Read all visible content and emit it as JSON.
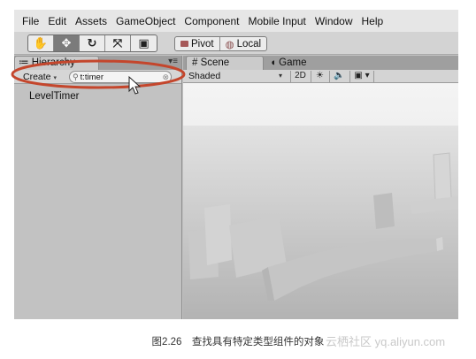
{
  "menubar": {
    "items": [
      "File",
      "Edit",
      "Assets",
      "GameObject",
      "Component",
      "Mobile Input",
      "Window",
      "Help"
    ]
  },
  "toolbar": {
    "tools": [
      {
        "icon": "hand-icon",
        "glyph": "✋"
      },
      {
        "icon": "move-icon",
        "glyph": "✥"
      },
      {
        "icon": "rotate-icon",
        "glyph": "↻"
      },
      {
        "icon": "scale-icon",
        "glyph": "⤧"
      },
      {
        "icon": "rect-icon",
        "glyph": "▣"
      }
    ],
    "active_tool": 1,
    "pivot_label": "Pivot",
    "local_label": "Local"
  },
  "hierarchy": {
    "tab_label": "Hierarchy",
    "create_label": "Create",
    "search_value": "t:timer",
    "items": [
      "LevelTimer"
    ]
  },
  "scene": {
    "tab_scene": "Scene",
    "tab_game": "Game",
    "shading_mode": "Shaded",
    "mode_2d": "2D"
  },
  "colors": {
    "highlight_ellipse": "#c4462c",
    "panel_bg": "#c2c2c2",
    "toolbar_bg": "#d3d3d3"
  },
  "caption": "图2.26　查找具有特定类型组件的对象",
  "watermark": "云栖社区 yq.aliyun.com"
}
